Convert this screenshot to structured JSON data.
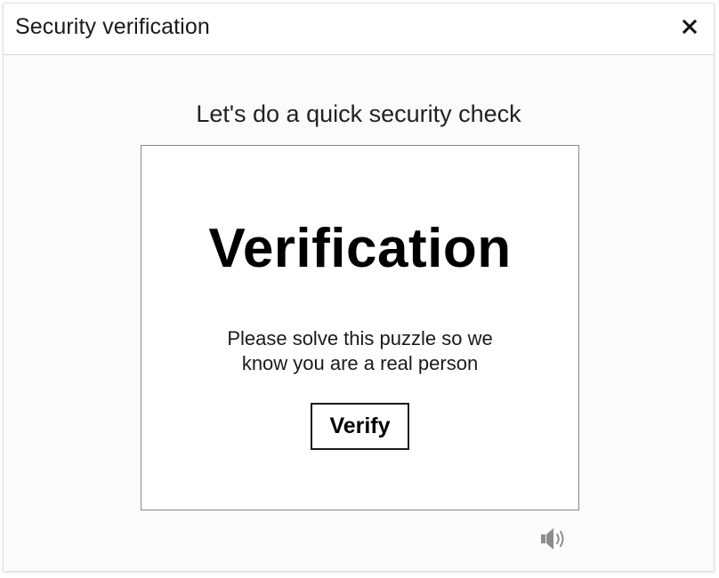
{
  "dialog": {
    "title": "Security verification",
    "close_icon": "close-icon"
  },
  "challenge": {
    "subtitle": "Let's do a quick security check",
    "heading": "Verification",
    "description_line1": "Please solve this puzzle so we",
    "description_line2": "know you are a real person",
    "verify_label": "Verify",
    "audio_icon": "speaker-audio-icon"
  },
  "colors": {
    "frame_border": "#8a8a8a",
    "header_border": "#d9d9d9",
    "audio_icon": "#8c8c8c"
  }
}
